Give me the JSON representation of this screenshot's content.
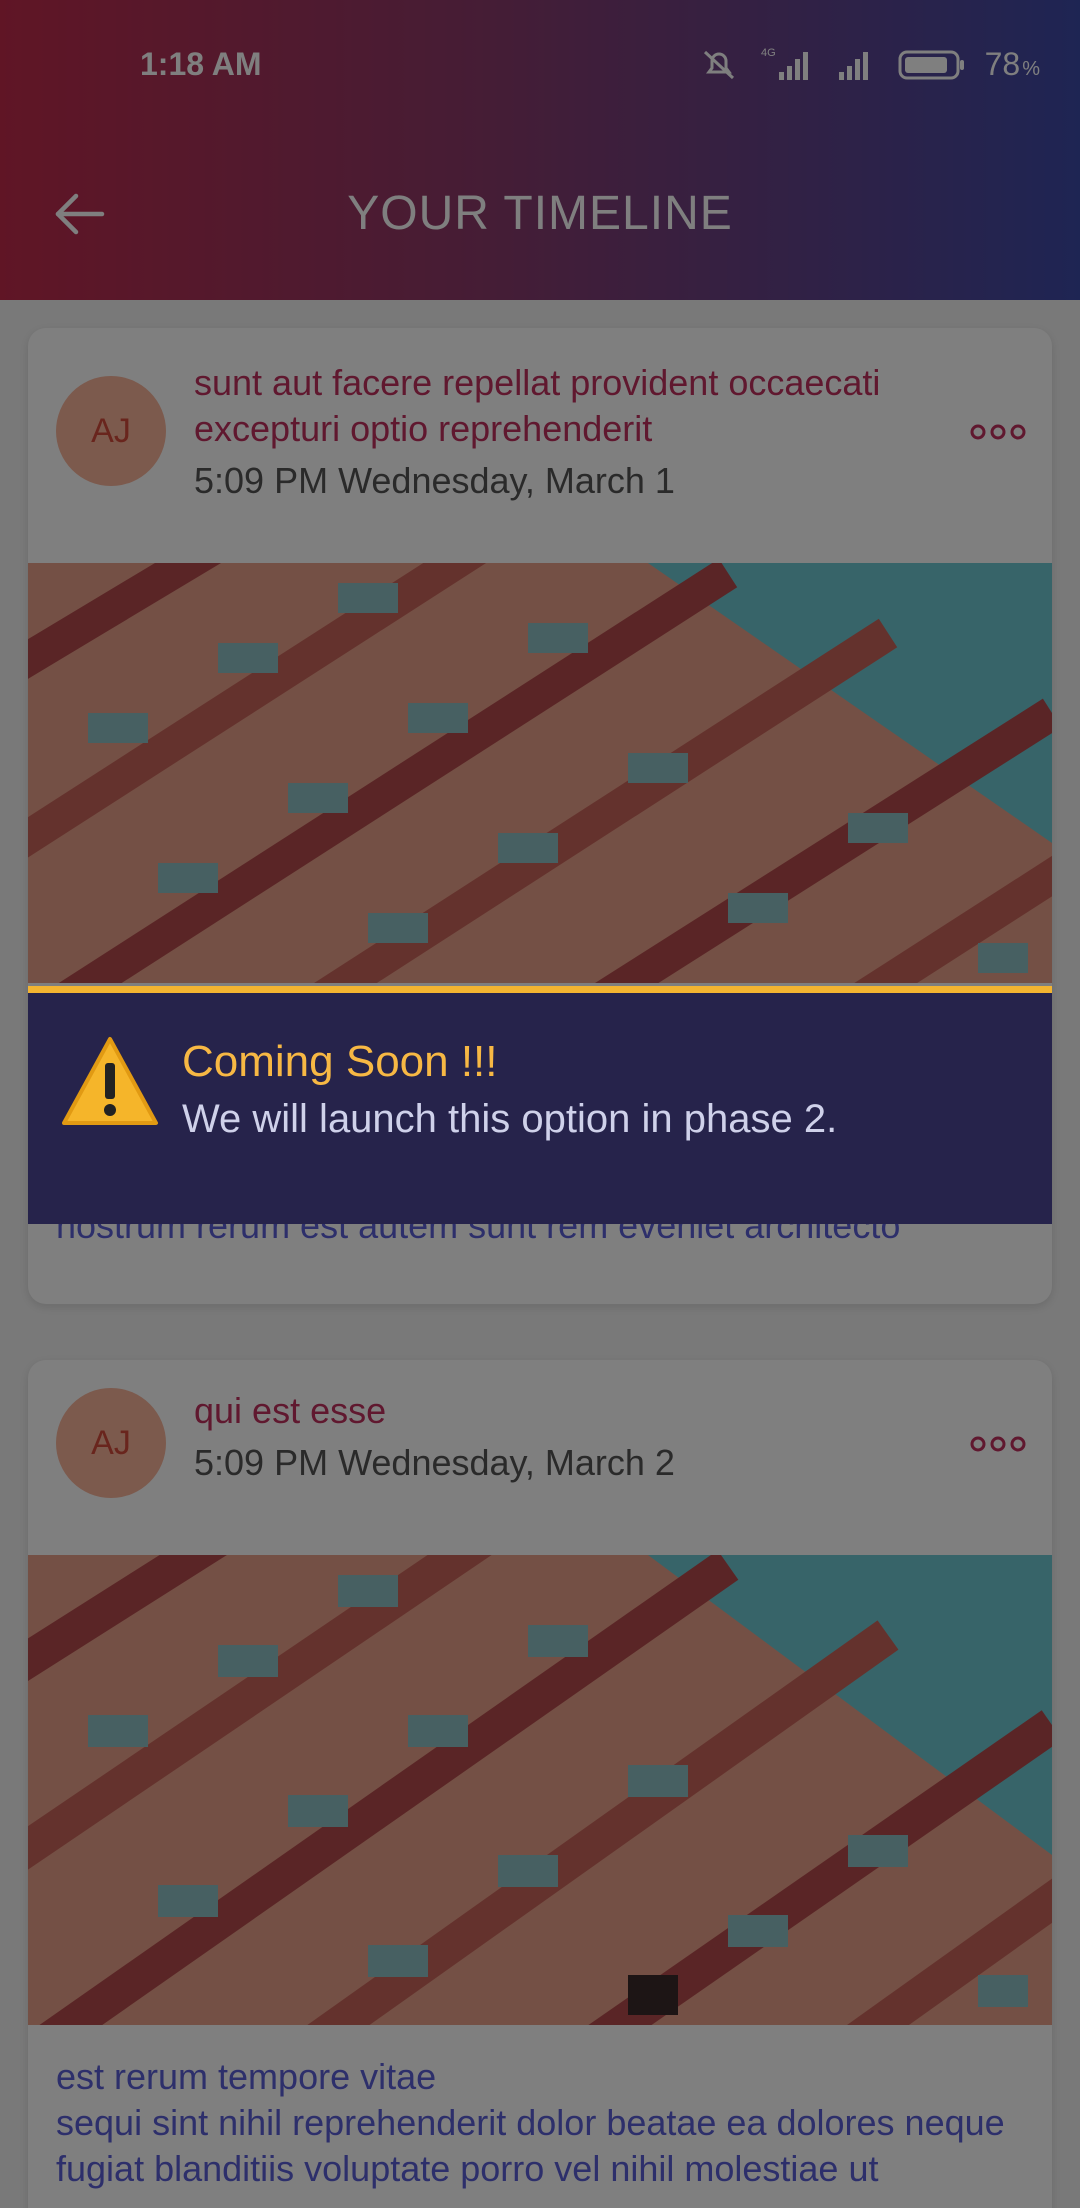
{
  "status_bar": {
    "time": "1:18 AM",
    "network": "4G",
    "battery_percent": "78",
    "percent_sign": "%"
  },
  "header": {
    "title": "YOUR TIMELINE",
    "back_icon": "back-arrow-icon"
  },
  "posts": [
    {
      "avatar_initials": "AJ",
      "title": "sunt aut facere repellat provident occaecati excepturi optio reprehenderit",
      "timestamp": "5:09 PM Wednesday, March 1",
      "body": "nostrum rerum est autem sunt rem eveniet architecto"
    },
    {
      "avatar_initials": "AJ",
      "title": "qui est esse",
      "timestamp": "5:09 PM Wednesday, March 2",
      "body": "est rerum tempore vitae\nsequi sint nihil reprehenderit dolor beatae ea dolores neque\nfugiat blanditiis voluptate porro vel nihil molestiae ut"
    }
  ],
  "toast": {
    "title": "Coming Soon !!!",
    "message": "We will launch this option in phase 2.",
    "accent": "#f3b431",
    "background": "#26234b"
  }
}
